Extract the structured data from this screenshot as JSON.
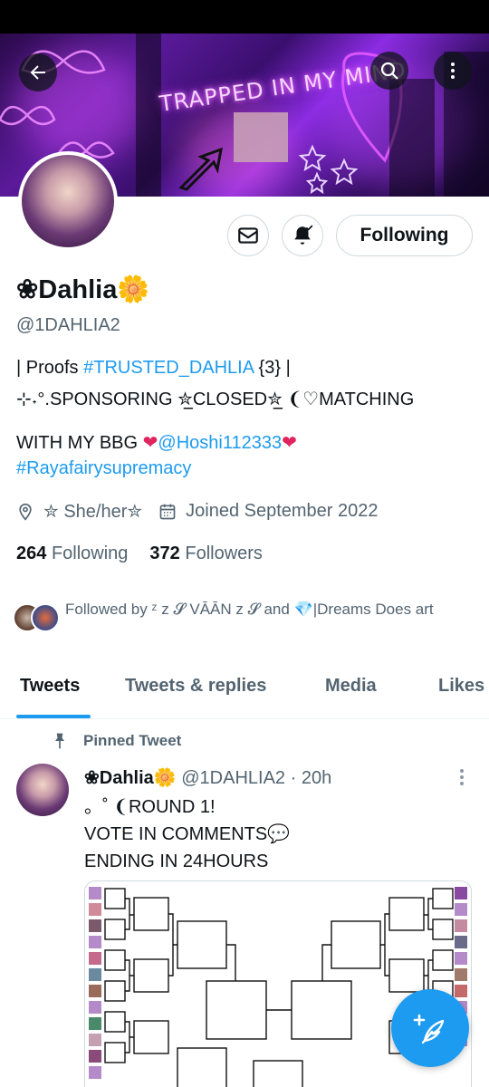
{
  "header": {
    "banner_text": "TRAPPED IN MY MIND"
  },
  "profile": {
    "name": "❀Dahlia🌼",
    "handle": "@1DAHLIA2",
    "follow_button": "Following",
    "bio_line1_a": "| Proofs ",
    "bio_line1_link": "#TRUSTED_DAHLIA",
    "bio_line1_b": " {3} |",
    "bio_line2": "⊹˖°.SPONSORING ✮̲CLOSED✮̲ ❨♡MATCHING",
    "bio_line3_a": "WITH MY BBG ❤️",
    "bio_line3_link": "@Hoshi112333",
    "bio_line3_b": "❤️",
    "bio_line4_link": "#Rayafairysupremacy",
    "location": "✮ She/her✮",
    "joined": "Joined September 2022",
    "following_count": "264",
    "following_label": "Following",
    "followers_count": "372",
    "followers_label": "Followers",
    "followed_by": "Followed by ᶻ z 𝓢 VĀĀN z 𝓢 and 💎|Dreams Does art"
  },
  "tabs": [
    {
      "label": "Tweets",
      "active": true
    },
    {
      "label": "Tweets & replies",
      "active": false
    },
    {
      "label": "Media",
      "active": false
    },
    {
      "label": "Likes",
      "active": false
    }
  ],
  "pinned": {
    "label": "Pinned Tweet",
    "author_name": "❀Dahlia🌼",
    "author_handle": "@1DAHLIA2",
    "time": "· 20h",
    "line1": "。˚ ❨ROUND 1!",
    "line2": "VOTE IN COMMENTS💬",
    "line3": "ENDING IN 24HOURS"
  },
  "colors": {
    "accent": "#1d9bf0",
    "text_primary": "#0f1419",
    "text_secondary": "#536471",
    "heart": "#e0245e"
  },
  "icons": {
    "back": "arrow-left-icon",
    "search": "search-icon",
    "more": "more-vertical-icon",
    "message": "envelope-icon",
    "notify": "bell-check-icon",
    "location": "location-pin-icon",
    "calendar": "calendar-icon",
    "pin": "pin-icon",
    "compose": "feather-plus-icon"
  }
}
